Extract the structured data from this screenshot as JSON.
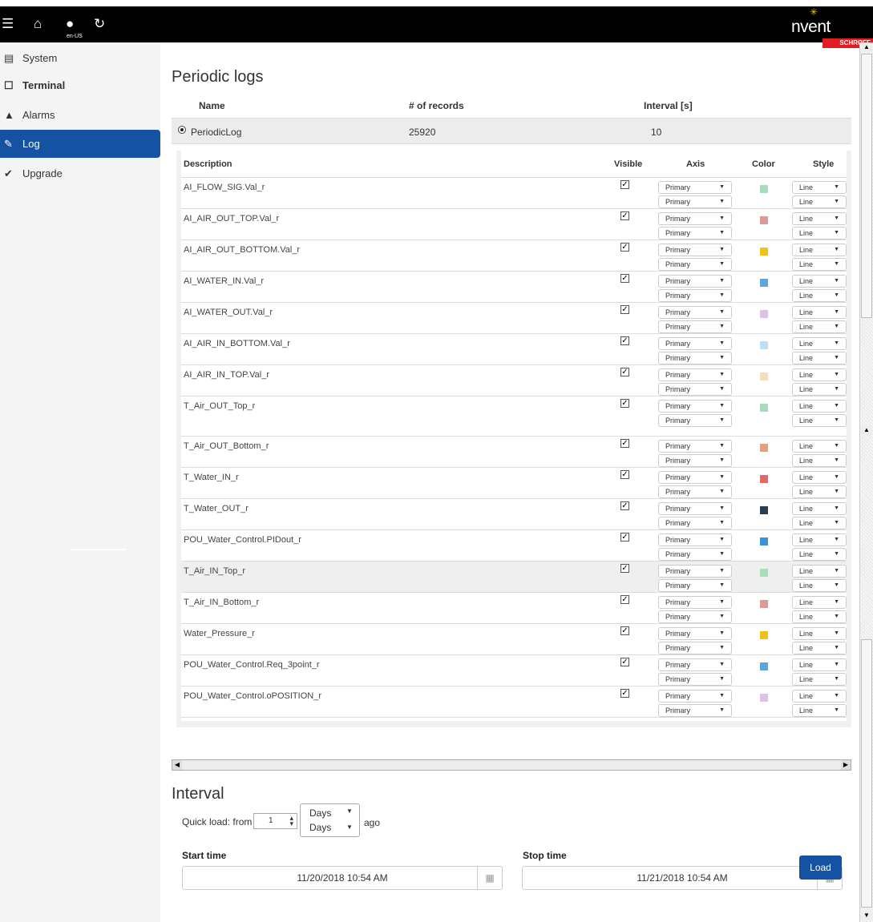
{
  "topbar": {
    "menu_icon": "menu-icon",
    "home_icon": "home-icon",
    "globe_icon": "globe-icon",
    "refresh_icon": "refresh-icon",
    "lang_label": "en-US",
    "brand": {
      "word": "nvent",
      "sub": "SCHROFF",
      "accent": "#f5c518",
      "sub_color": "#e31c23"
    }
  },
  "sidebar": {
    "items": [
      {
        "label": "System",
        "icon": "server-icon"
      },
      {
        "label": "Terminal",
        "icon": "terminal-icon"
      },
      {
        "label": "Alarms",
        "icon": "bell-icon"
      },
      {
        "label": "Log",
        "icon": "log-icon"
      },
      {
        "label": "Upgrade",
        "icon": "upgrade-icon"
      }
    ],
    "active_color": "#1552a3"
  },
  "periodic": {
    "title": "Periodic logs",
    "columns": {
      "name": "Name",
      "records": "# of records",
      "interval": "Interval [s]"
    },
    "row": {
      "name": "PeriodicLog",
      "records": "25920",
      "interval": "10"
    }
  },
  "signals": {
    "columns": {
      "description": "Description",
      "visible": "Visible",
      "axis": "Axis",
      "color": "Color",
      "style": "Style"
    },
    "axis_value": "Primary",
    "style_value": "Line",
    "rows": [
      {
        "desc": "AI_FLOW_SIG.Val_r",
        "color": "#a6dcba"
      },
      {
        "desc": "AI_AIR_OUT_TOP.Val_r",
        "color": "#dd9a94"
      },
      {
        "desc": "AI_AIR_OUT_BOTTOM.Val_r",
        "color": "#f2c01a"
      },
      {
        "desc": "AI_WATER_IN.Val_r",
        "color": "#5aa7dc"
      },
      {
        "desc": "AI_WATER_OUT.Val_r",
        "color": "#dcc2e4"
      },
      {
        "desc": "AI_AIR_IN_BOTTOM.Val_r",
        "color": "#bfe0f2"
      },
      {
        "desc": "AI_AIR_IN_TOP.Val_r",
        "color": "#f6dcc0"
      },
      {
        "desc": "T_Air_OUT_Top_r",
        "color": "#a6dcba"
      },
      {
        "desc": "T_Air_OUT_Bottom_r",
        "color": "#e5a07e"
      },
      {
        "desc": "T_Water_IN_r",
        "color": "#e06a66"
      },
      {
        "desc": "T_Water_OUT_r",
        "color": "#2c3e50"
      },
      {
        "desc": "POU_Water_Control.PIDout_r",
        "color": "#3a93d9"
      },
      {
        "desc": "T_Air_IN_Top_r",
        "color": "#a8dfba"
      },
      {
        "desc": "T_Air_IN_Bottom_r",
        "color": "#dd9a94"
      },
      {
        "desc": "Water_Pressure_r",
        "color": "#f2c01a"
      },
      {
        "desc": "POU_Water_Control.Req_3point_r",
        "color": "#5aa7dc"
      },
      {
        "desc": "POU_Water_Control.oPOSITION_r",
        "color": "#dcc2e4"
      }
    ]
  },
  "interval": {
    "title": "Interval",
    "quick_prefix": "Quick load: from",
    "quick_value": "1",
    "unit_options": [
      "Days",
      "Days"
    ],
    "suffix": "ago",
    "start_label": "Start time",
    "start_value": "11/20/2018 10:54 AM",
    "stop_label": "Stop time",
    "stop_value": "11/21/2018 10:54 AM",
    "load_label": "Load"
  }
}
